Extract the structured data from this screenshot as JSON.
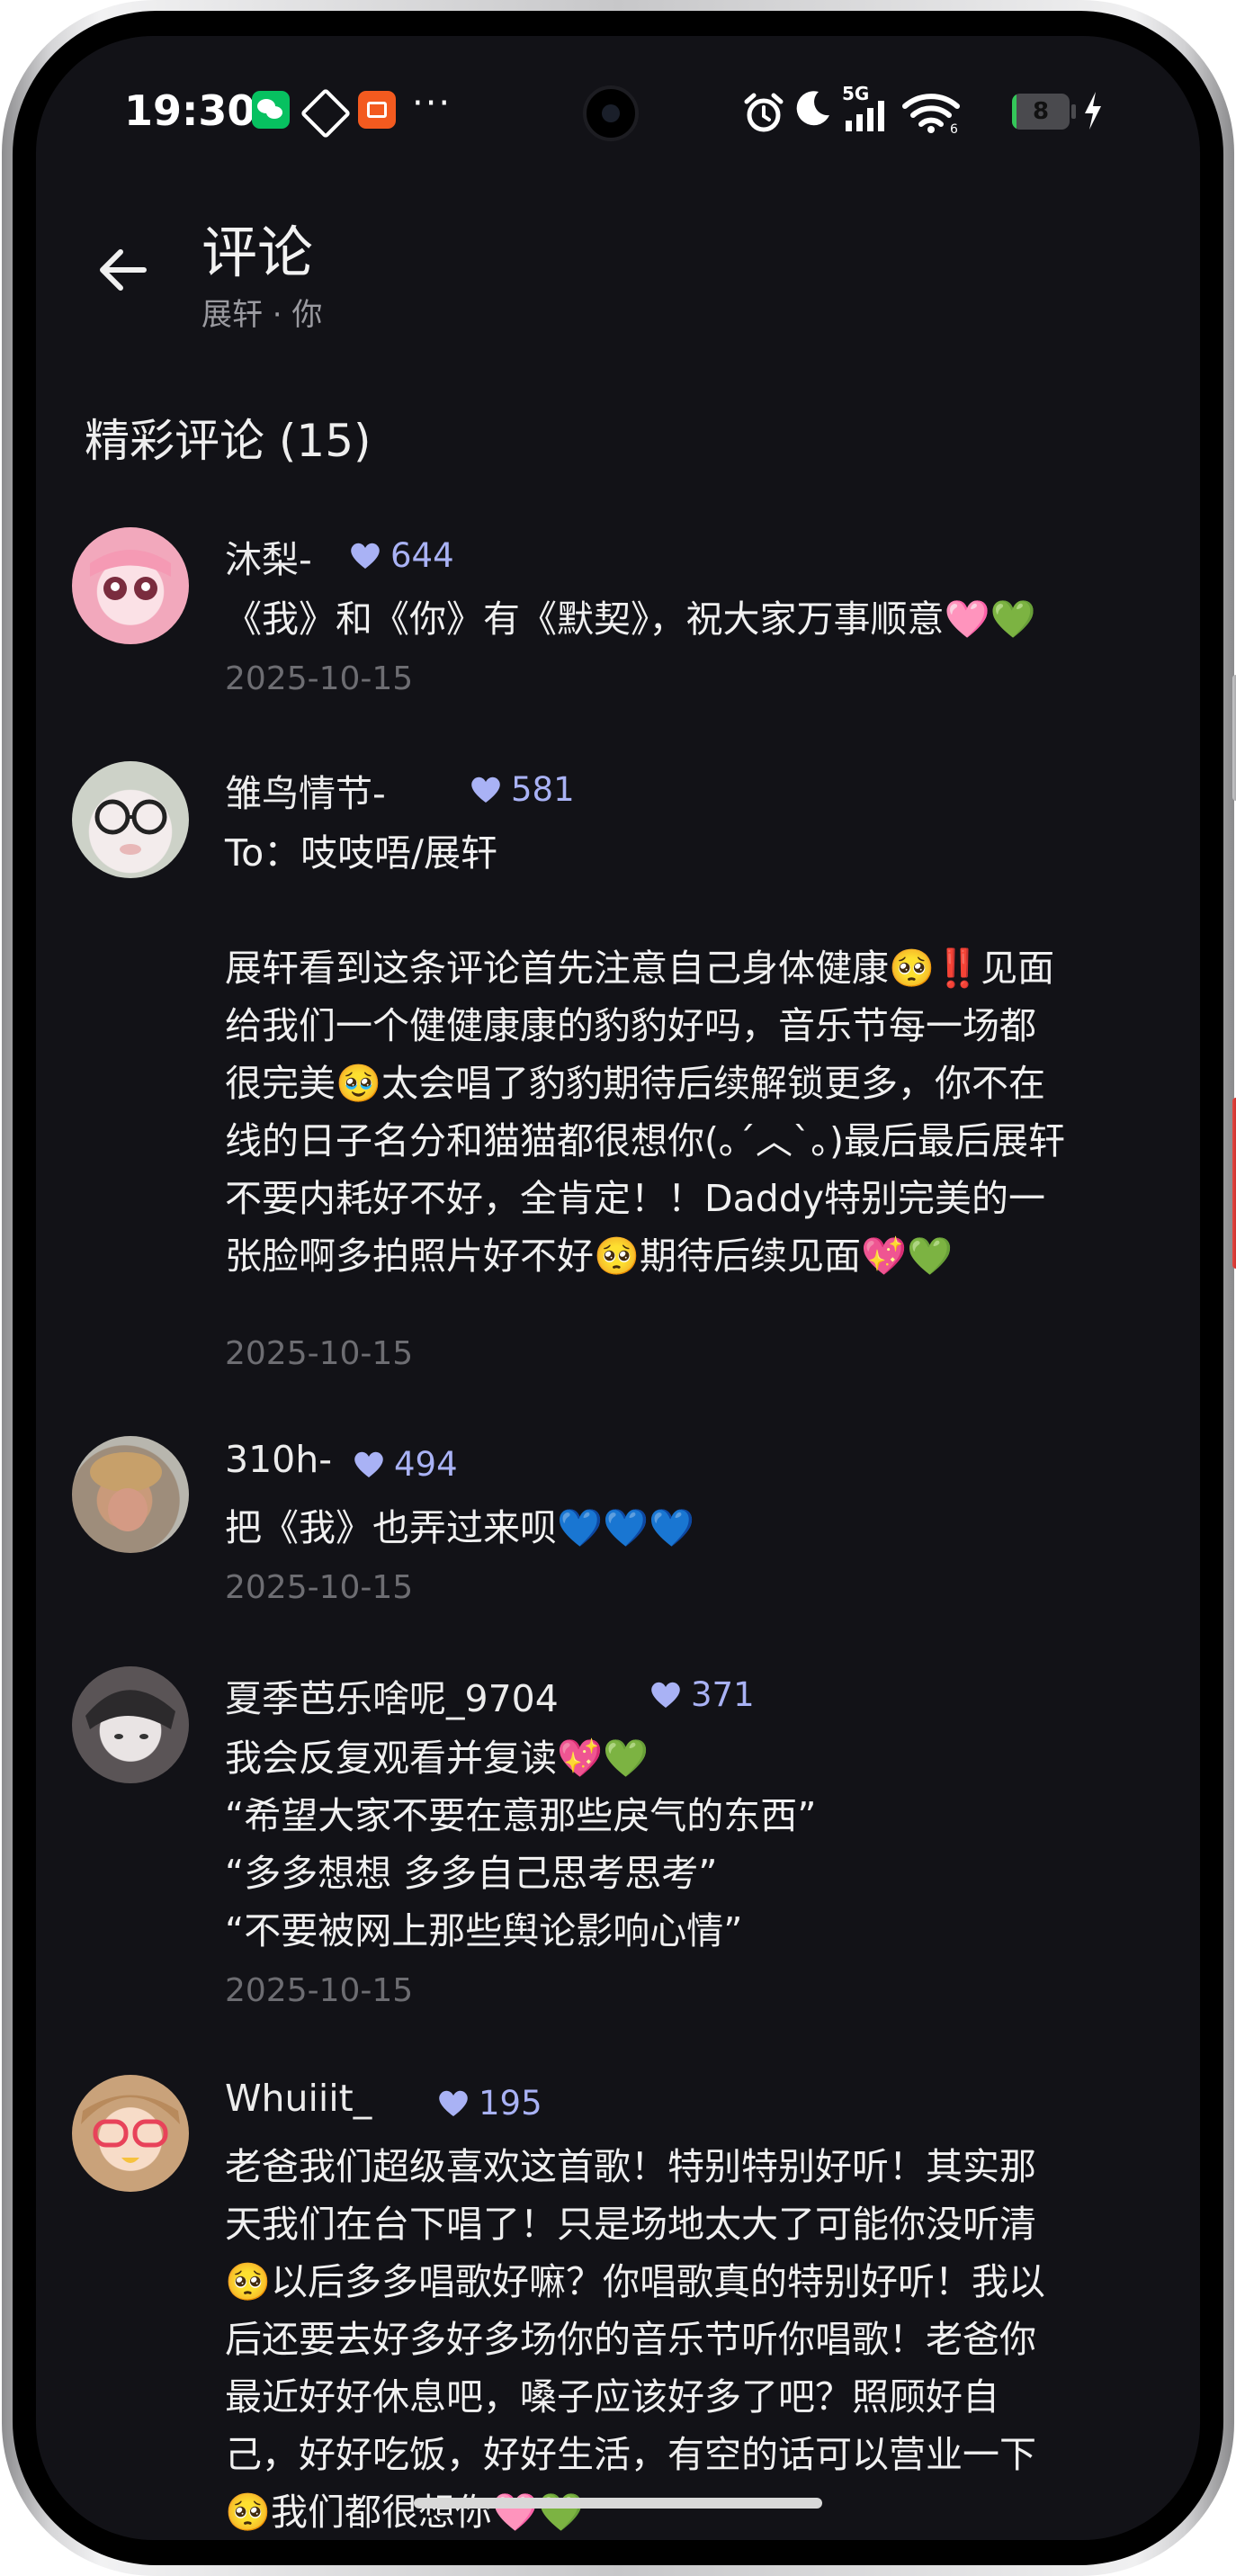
{
  "status_bar": {
    "time": "19:30",
    "network": "5G",
    "battery": "8",
    "battery_level": 0.08
  },
  "header": {
    "title": "评论",
    "subtitle": "展轩 · 你"
  },
  "section": {
    "title": "精彩评论 (15)"
  },
  "comments": [
    {
      "username": "沐梨-",
      "likes": "644",
      "text": "《我》和《你》有《默契》，祝大家万事顺意🩷💚",
      "date": "2025-10-15"
    },
    {
      "username": "雏鸟情节-",
      "likes": "581",
      "text": "To：吱吱唔/展轩\n\n展轩看到这条评论首先注意自己身体健康🥺‼️见面\n给我们一个健健康康的豹豹好吗，音乐节每一场都\n很完美🥹太会唱了豹豹期待后续解锁更多，你不在\n线的日子名分和猫猫都很想你(｡´︿`｡)最后最后展轩\n不要内耗好不好，全肯定！！Daddy特别完美的一\n张脸啊多拍照片好不好🥺期待后续见面💖💚",
      "date": "2025-10-15"
    },
    {
      "username": "310h-",
      "likes": "494",
      "text": "把《我》也弄过来呗💙💙💙",
      "date": "2025-10-15"
    },
    {
      "username": "夏季芭乐啥呢_9704",
      "likes": "371",
      "text": "我会反复观看并复读💖💚\n“希望大家不要在意那些戾气的东西”\n“多多想想 多多自己思考思考”\n“不要被网上那些舆论影响心情”",
      "date": "2025-10-15"
    },
    {
      "username": "Whuiiit_",
      "likes": "195",
      "text": "老爸我们超级喜欢这首歌！特别特别好听！其实那\n天我们在台下唱了！只是场地太大了可能你没听清\n🥺以后多多唱歌好嘛？你唱歌真的特别好听！我以\n后还要去好多好多场你的音乐节听你唱歌！老爸你\n最近好好休息吧，嗓子应该好多了吧？照顾好自\n己，好好吃饭，好好生活，有空的话可以营业一下\n🥺我们都很想你🩷💚",
      "date": ""
    }
  ]
}
